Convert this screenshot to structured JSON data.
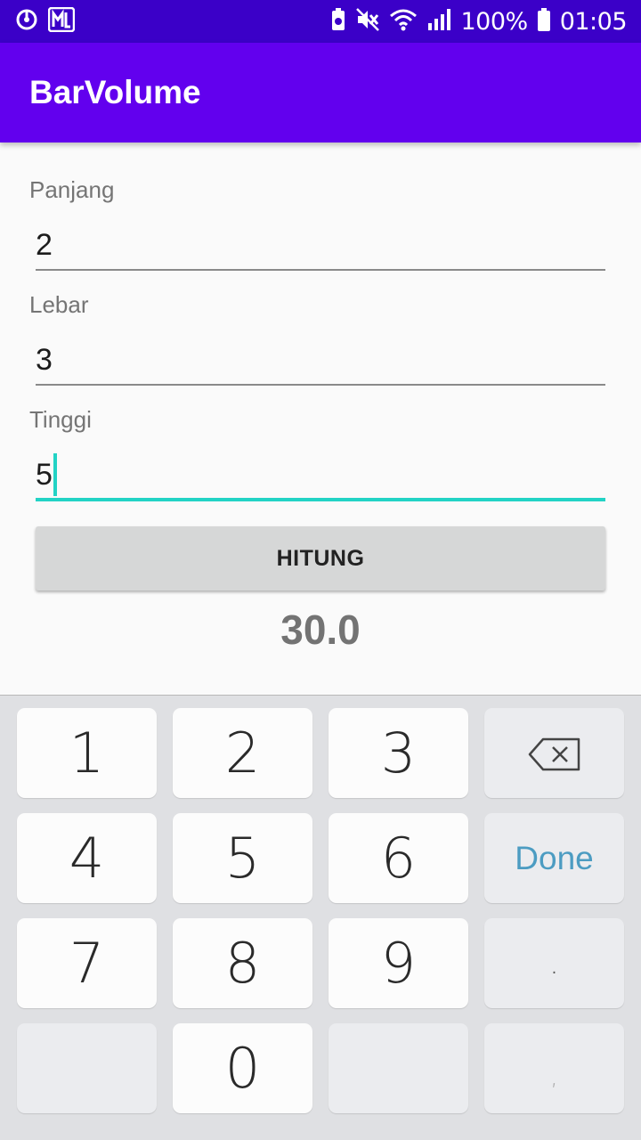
{
  "status_bar": {
    "battery": "100%",
    "time": "01:05",
    "icons": [
      "data-saver-icon",
      "ml-app-icon",
      "battery-saver-icon",
      "mute-icon",
      "wifi-icon",
      "signal-icon",
      "battery-icon"
    ],
    "background_color": "#3b00c8"
  },
  "app_bar": {
    "title": "BarVolume",
    "background_color": "#6200ee"
  },
  "form": {
    "panjang": {
      "label": "Panjang",
      "value": "2"
    },
    "lebar": {
      "label": "Lebar",
      "value": "3"
    },
    "tinggi": {
      "label": "Tinggi",
      "value": "5"
    },
    "accent_color": "#22d3c5"
  },
  "hitung_button": {
    "label": "HITUNG"
  },
  "result": {
    "value": "30.0"
  },
  "keyboard": {
    "keys": [
      "1",
      "2",
      "3",
      "4",
      "5",
      "6",
      "7",
      "8",
      "9",
      "0"
    ],
    "done_label": "Done",
    "dot_label": ".",
    "comma_label": ",",
    "backspace_icon": "backspace-icon",
    "done_color": "#4c9cc2"
  }
}
